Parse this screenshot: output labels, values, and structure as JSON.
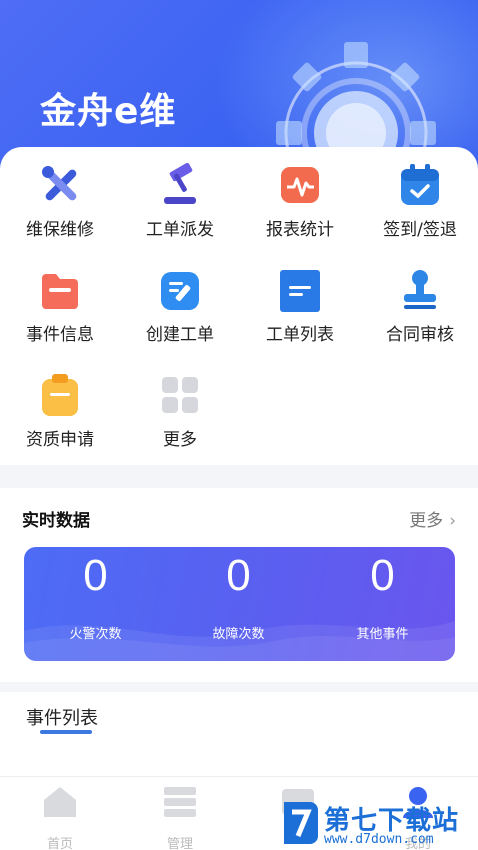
{
  "header": {
    "app_title": "金舟e维"
  },
  "menu": [
    {
      "label": "维保维修",
      "icon": "tools-icon"
    },
    {
      "label": "工单派发",
      "icon": "gavel-icon"
    },
    {
      "label": "报表统计",
      "icon": "chart-pulse-icon"
    },
    {
      "label": "签到/签退",
      "icon": "calendar-check-icon"
    },
    {
      "label": "事件信息",
      "icon": "folder-icon"
    },
    {
      "label": "创建工单",
      "icon": "edit-icon"
    },
    {
      "label": "工单列表",
      "icon": "document-list-icon"
    },
    {
      "label": "合同审核",
      "icon": "stamp-icon"
    },
    {
      "label": "资质申请",
      "icon": "clipboard-icon"
    },
    {
      "label": "更多",
      "icon": "grid-more-icon"
    }
  ],
  "realtime": {
    "title": "实时数据",
    "more_label": "更多",
    "stats": [
      {
        "value": "0",
        "label": "火警次数"
      },
      {
        "value": "0",
        "label": "故障次数"
      },
      {
        "value": "0",
        "label": "其他事件"
      }
    ]
  },
  "events": {
    "title": "事件列表"
  },
  "tabbar": [
    {
      "label": "首页",
      "icon": "home-icon"
    },
    {
      "label": "管理",
      "icon": "list-icon"
    },
    {
      "label": "",
      "icon": "message-icon"
    },
    {
      "label": "我的",
      "icon": "user-icon"
    }
  ],
  "watermark": {
    "title": "第七下载站",
    "url": "www.d7down.com"
  },
  "colors": {
    "brand_blue": "#3a63f2",
    "accent_purple": "#6a56ee"
  }
}
